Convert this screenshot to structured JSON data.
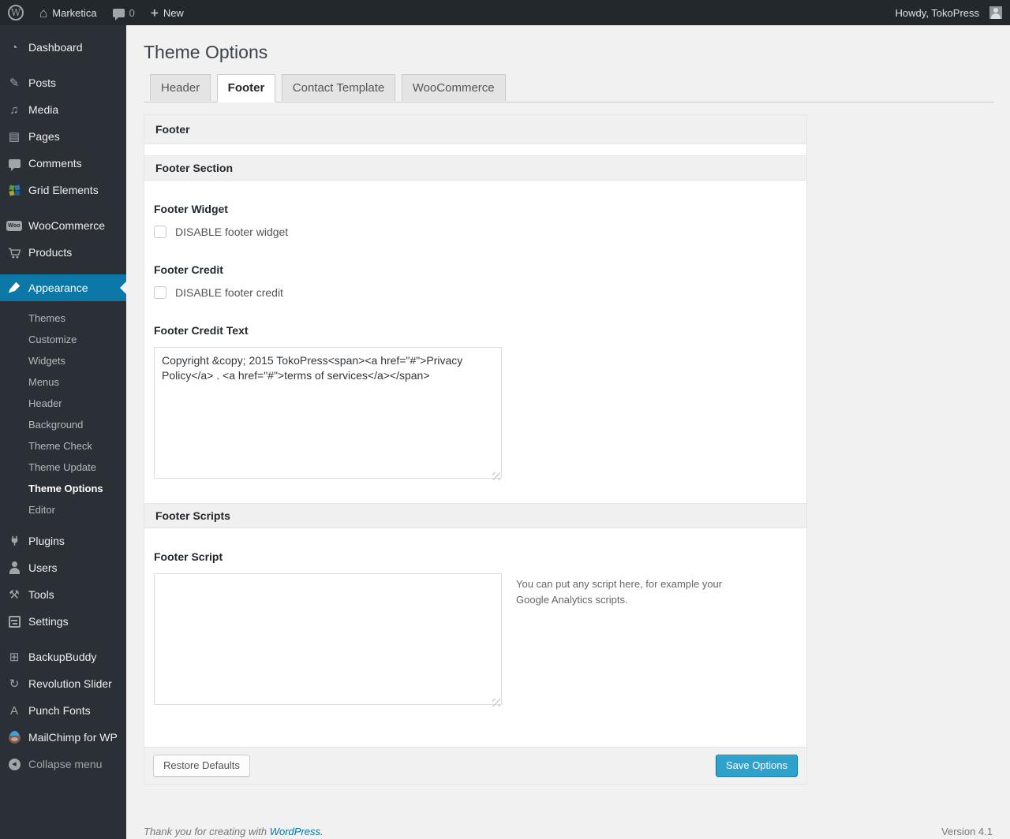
{
  "colors": {
    "admin_bar_bg": "#23282d",
    "sidebar_bg": "#2a3036",
    "menu_highlight": "#0c78a8",
    "link_accent": "#0074a2",
    "button_primary_bg": "#2ea2cc",
    "content_bg": "#f1f1f1"
  },
  "icons": {
    "wp_logo": "W",
    "home": "⌂",
    "comments_bubble": "css-bubble",
    "plus": "+",
    "avatar": "css-silhouette",
    "dashboard": "◔",
    "posts": "✎",
    "media": "♫",
    "pages": "▤",
    "comments": "css-bubble",
    "grid_elements": "css-colored-squares",
    "woocommerce": "Woo",
    "products_cart": "svg-cart",
    "appearance_brush": "svg-brush",
    "plugins_plug": "svg-plug",
    "users": "css-person",
    "tools": "⚒",
    "settings": "css-sliders",
    "backupbuddy": "⊞",
    "revolution_slider": "↻",
    "punch_fonts": "A",
    "mailchimp": "css-monkey",
    "collapse_arrow": "◀"
  },
  "admin_bar": {
    "site_name": "Marketica",
    "comments_count": "0",
    "new_label": "New",
    "howdy": "Howdy, TokoPress"
  },
  "sidebar": {
    "items": [
      {
        "label": "Dashboard"
      },
      {
        "label": "Posts"
      },
      {
        "label": "Media"
      },
      {
        "label": "Pages"
      },
      {
        "label": "Comments"
      },
      {
        "label": "Grid Elements"
      },
      {
        "label": "WooCommerce"
      },
      {
        "label": "Products"
      },
      {
        "label": "Appearance",
        "active": true
      },
      {
        "label": "Plugins"
      },
      {
        "label": "Users"
      },
      {
        "label": "Tools"
      },
      {
        "label": "Settings"
      },
      {
        "label": "BackupBuddy"
      },
      {
        "label": "Revolution Slider"
      },
      {
        "label": "Punch Fonts"
      },
      {
        "label": "MailChimp for WP"
      },
      {
        "label": "Collapse menu"
      }
    ],
    "appearance_submenu": [
      {
        "label": "Themes"
      },
      {
        "label": "Customize"
      },
      {
        "label": "Widgets"
      },
      {
        "label": "Menus"
      },
      {
        "label": "Header"
      },
      {
        "label": "Background"
      },
      {
        "label": "Theme Check"
      },
      {
        "label": "Theme Update"
      },
      {
        "label": "Theme Options",
        "current": true
      },
      {
        "label": "Editor"
      }
    ]
  },
  "page": {
    "title": "Theme Options",
    "tabs": [
      {
        "label": "Header",
        "active": false
      },
      {
        "label": "Footer",
        "active": true
      },
      {
        "label": "Contact Template",
        "active": false
      },
      {
        "label": "WooCommerce",
        "active": false
      }
    ],
    "panel_title": "Footer",
    "sections": {
      "footer_section": {
        "title": "Footer Section",
        "footer_widget": {
          "label": "Footer Widget",
          "checkbox_label": "DISABLE footer widget",
          "checked": false
        },
        "footer_credit": {
          "label": "Footer Credit",
          "checkbox_label": "DISABLE footer credit",
          "checked": false
        },
        "footer_credit_text": {
          "label": "Footer Credit Text",
          "value": "Copyright &copy; 2015 TokoPress<span><a href=\"#\">Privacy Policy</a> . <a href=\"#\">terms of services</a></span>"
        }
      },
      "footer_scripts": {
        "title": "Footer Scripts",
        "footer_script": {
          "label": "Footer Script",
          "value": "",
          "help": "You can put any script here, for example your Google Analytics scripts."
        }
      }
    },
    "actions": {
      "restore_label": "Restore Defaults",
      "save_label": "Save Options"
    }
  },
  "footer": {
    "thanks": "Thank you for creating with",
    "wordpress": "WordPress.",
    "version": "Version 4.1"
  }
}
